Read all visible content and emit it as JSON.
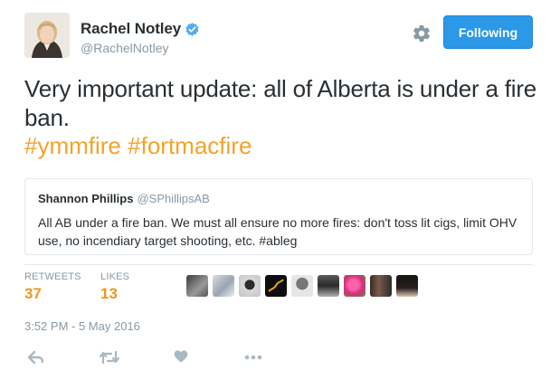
{
  "author": {
    "display_name": "Rachel Notley",
    "handle": "@RachelNotley",
    "verified": true
  },
  "follow_button": {
    "label": "Following"
  },
  "tweet": {
    "text": "Very important update: all of Alberta is under a fire ban.",
    "hashtags": [
      "#ymmfire",
      "#fortmacfire"
    ]
  },
  "quoted_tweet": {
    "display_name": "Shannon Phillips",
    "handle": "@SPhillipsAB",
    "text": "All AB under a fire ban.  We must all ensure no more fires: don't toss lit cigs, limit OHV use, no incendiary target shooting, etc.  #ableg"
  },
  "stats": {
    "retweets_label": "RETWEETS",
    "retweets_value": "37",
    "likes_label": "LIKES",
    "likes_value": "13"
  },
  "timestamp": "3:52 PM - 5 May 2016",
  "icons": {
    "settings": "gear-icon",
    "reply": "reply-icon",
    "retweet": "retweet-icon",
    "like": "heart-icon",
    "more": "more-icon",
    "verified": "verified-badge-icon"
  },
  "colors": {
    "accent_blue": "#2b98e8",
    "hashtag": "#f3a32c",
    "stat_value": "#f0971c",
    "muted": "#8899a6"
  }
}
